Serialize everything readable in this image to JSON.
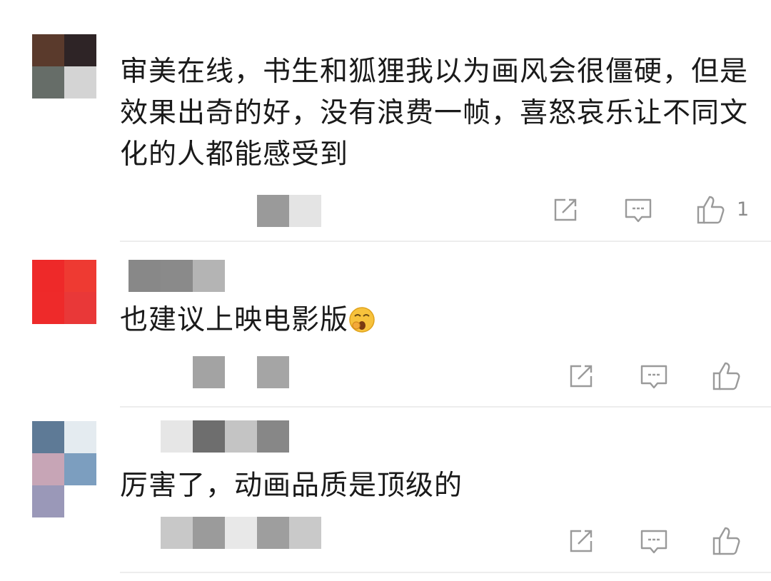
{
  "comments": [
    {
      "text": "审美在线，书生和狐狸我以为画风会很僵硬，但是效果出奇的好，没有浪费一帧，喜怒哀乐让不同文化的人都能感受到",
      "like_count": "1",
      "avatar_colors": [
        "#5a3a2c",
        "#2e2426",
        "#666d68",
        "#d4d4d4"
      ],
      "meta_colors": [
        "#9a9a9a",
        "#e4e4e4"
      ],
      "username_colors": []
    },
    {
      "text": "也建议上映电影版",
      "emoji": "yawning-face",
      "like_count": "",
      "avatar_colors": [
        "#ee2929",
        "#ee3a32",
        "#ee2a2a",
        "#e93838"
      ],
      "meta_colors": [
        "#a3a3a3",
        "#a5a5a5"
      ],
      "username_colors": [
        "#888888",
        "#8a8a8a",
        "#b4b4b4"
      ]
    },
    {
      "text": "厉害了，动画品质是顶级的",
      "like_count": "",
      "avatar_colors": [
        "#5e7a96",
        "#e4ebf0",
        "#c7a5b6",
        "#7c9ebf",
        "#9a98b8"
      ],
      "meta_colors": [
        "#c8c8c8",
        "#9b9b9b",
        "#e8e8e8",
        "#9e9e9e",
        "#c9c9c9"
      ],
      "username_colors": [
        "#e6e6e6",
        "#6e6e6e",
        "#c4c4c4",
        "#878787"
      ]
    }
  ],
  "icons": [
    "share-icon",
    "reply-icon",
    "like-icon"
  ],
  "colors": {
    "icon_stroke": "#9a9a9a",
    "divider": "#ededed",
    "text": "#1a1a1a"
  }
}
